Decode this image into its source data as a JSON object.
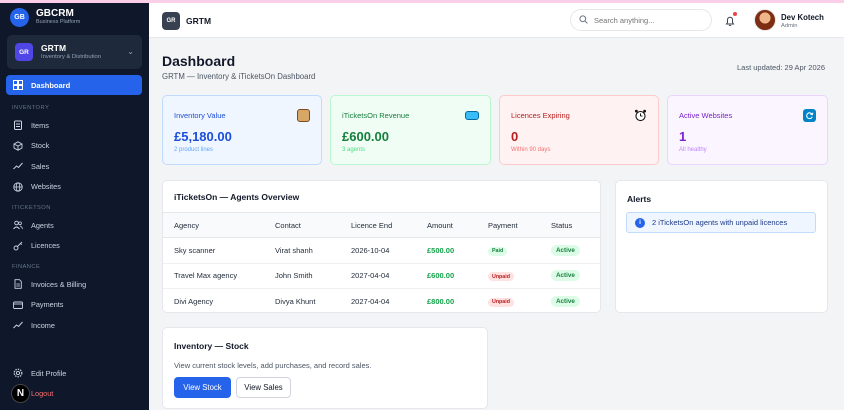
{
  "sidebar": {
    "brand_initials": "GB",
    "brand_title": "GBCRM",
    "brand_sub": "Business Platform",
    "org_initials": "GR",
    "org_name": "GRTM",
    "org_sub": "Inventory & Distribution",
    "active_item": "Dashboard",
    "sections": [
      {
        "title": "INVENTORY",
        "items": [
          "Items",
          "Stock",
          "Sales",
          "Websites"
        ]
      },
      {
        "title": "ITICKETSON",
        "items": [
          "Agents",
          "Licences"
        ]
      },
      {
        "title": "FINANCE",
        "items": [
          "Invoices & Billing",
          "Payments",
          "Income"
        ]
      }
    ],
    "edit_profile": "Edit Profile",
    "logout": "Logout",
    "n_badge": "N"
  },
  "topbar": {
    "initials": "GR",
    "title": "GRTM",
    "search_placeholder": "Search anything...",
    "user_name": "Dev Kotech",
    "user_role": "Admin"
  },
  "header": {
    "title": "Dashboard",
    "subtitle": "GRTM — Inventory & iTicketsOn Dashboard",
    "last_updated": "Last updated: 29 Apr 2026"
  },
  "cards": [
    {
      "label": "Inventory Value",
      "value": "£5,180.00",
      "sub": "2 product lines",
      "icon": "package-icon"
    },
    {
      "label": "iTicketsOn Revenue",
      "value": "£600.00",
      "sub": "3 agents",
      "icon": "ticket-icon"
    },
    {
      "label": "Licences Expiring",
      "value": "0",
      "sub": "Within 90 days",
      "icon": "alarm-clock-icon"
    },
    {
      "label": "Active Websites",
      "value": "1",
      "sub": "All healthy",
      "icon": "refresh-icon"
    }
  ],
  "agents": {
    "title": "iTicketsOn — Agents Overview",
    "columns": [
      "Agency",
      "Contact",
      "Licence End",
      "Amount",
      "Payment",
      "Status"
    ],
    "rows": [
      {
        "agency": "Sky scanner",
        "contact": "Virat shanh",
        "licence_end": "2026-10-04",
        "amount": "£500.00",
        "payment": "Paid",
        "status": "Active"
      },
      {
        "agency": "Travel Max agency",
        "contact": "John Smith",
        "licence_end": "2027-04-04",
        "amount": "£600.00",
        "payment": "Unpaid",
        "status": "Active"
      },
      {
        "agency": "Divi Agency",
        "contact": "Divya Khunt",
        "licence_end": "2027-04-04",
        "amount": "£800.00",
        "payment": "Unpaid",
        "status": "Active"
      }
    ]
  },
  "alerts": {
    "title": "Alerts",
    "items": [
      "2 iTicketsOn agents with unpaid licences"
    ]
  },
  "stock_panel": {
    "title": "Inventory — Stock",
    "description": "View current stock levels, add purchases, and record sales.",
    "primary_button": "View Stock",
    "secondary_button": "View Sales"
  },
  "colors": {
    "accent": "#2563eb",
    "sidebar_bg": "#0f172a",
    "card_blue": "#eff6ff",
    "card_green": "#f0fdf4",
    "card_red": "#fef2f2",
    "card_purple": "#faf5ff"
  }
}
